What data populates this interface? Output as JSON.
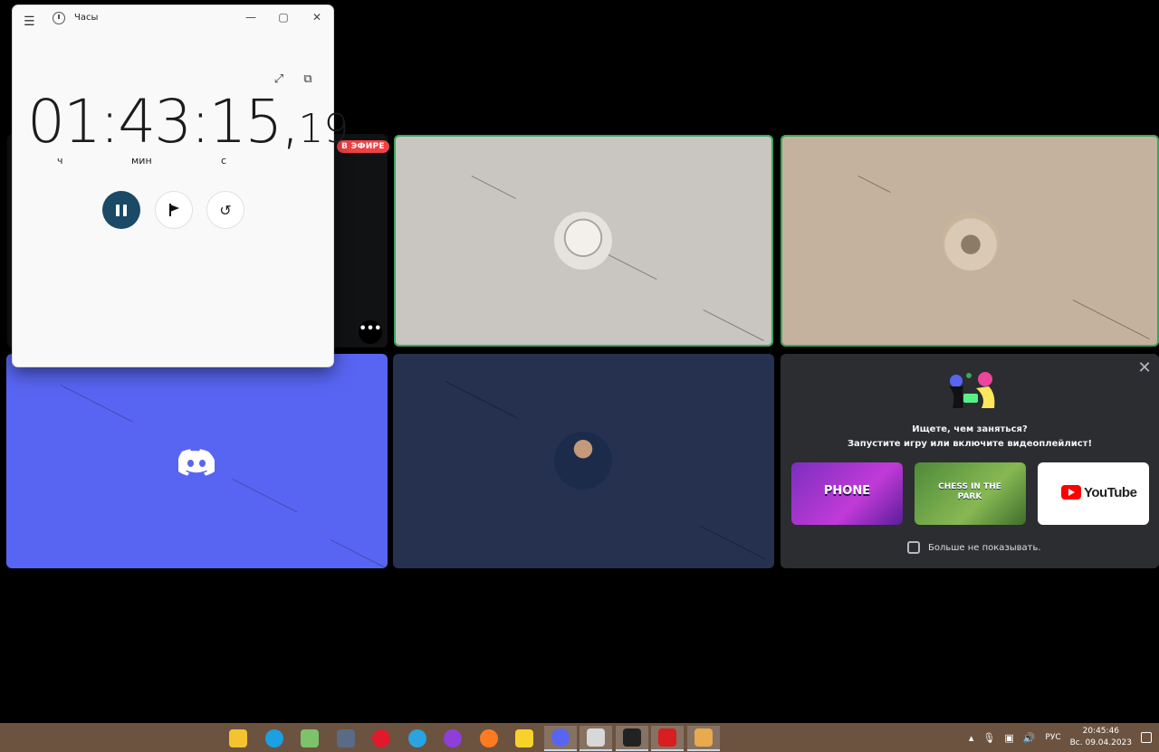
{
  "clock_window": {
    "title": "Часы",
    "time_main": "01:43:15,",
    "time_centiseconds": "19",
    "unit_hours": "ч",
    "unit_minutes": "мин",
    "unit_seconds": "с"
  },
  "call": {
    "live_badge": "В ЭФИРЕ",
    "more_glyph": "•••"
  },
  "activity_panel": {
    "title": "Ищете, чем заняться?",
    "subtitle": "Запустите игру или включите видеоплейлист!",
    "cards": [
      {
        "label": "PHONE",
        "name": "gartic-phone"
      },
      {
        "label": "CHESS IN THE PARK",
        "name": "chess-in-the-park"
      },
      {
        "label": "YouTube",
        "name": "youtube"
      }
    ],
    "dont_show_label": "Больше не показывать.",
    "close_glyph": "✕"
  },
  "taskbar": {
    "apps": [
      {
        "name": "file-explorer-icon",
        "color": "#f4c430"
      },
      {
        "name": "edge-icon",
        "color": "#1ba0e1"
      },
      {
        "name": "notepad-icon",
        "color": "#7cc36b"
      },
      {
        "name": "calculator-icon",
        "color": "#5a6b86"
      },
      {
        "name": "opera-icon",
        "color": "#e0192d"
      },
      {
        "name": "telegram-icon",
        "color": "#2aa3e0"
      },
      {
        "name": "podcast-icon",
        "color": "#8e3fd9"
      },
      {
        "name": "firefox-icon",
        "color": "#ff7b22"
      },
      {
        "name": "sticky-notes-icon",
        "color": "#f7d22b"
      },
      {
        "name": "discord-taskbar-icon",
        "color": "#5865f2"
      },
      {
        "name": "clock-taskbar-icon",
        "color": "#d8d8d8"
      },
      {
        "name": "terminal-icon",
        "color": "#222222"
      },
      {
        "name": "pdf-icon",
        "color": "#d81e1e"
      },
      {
        "name": "profile-app-icon",
        "color": "#e9a94e"
      }
    ],
    "lang": "РУС",
    "time": "20:45:46",
    "date": "Вс. 09.04.2023"
  }
}
